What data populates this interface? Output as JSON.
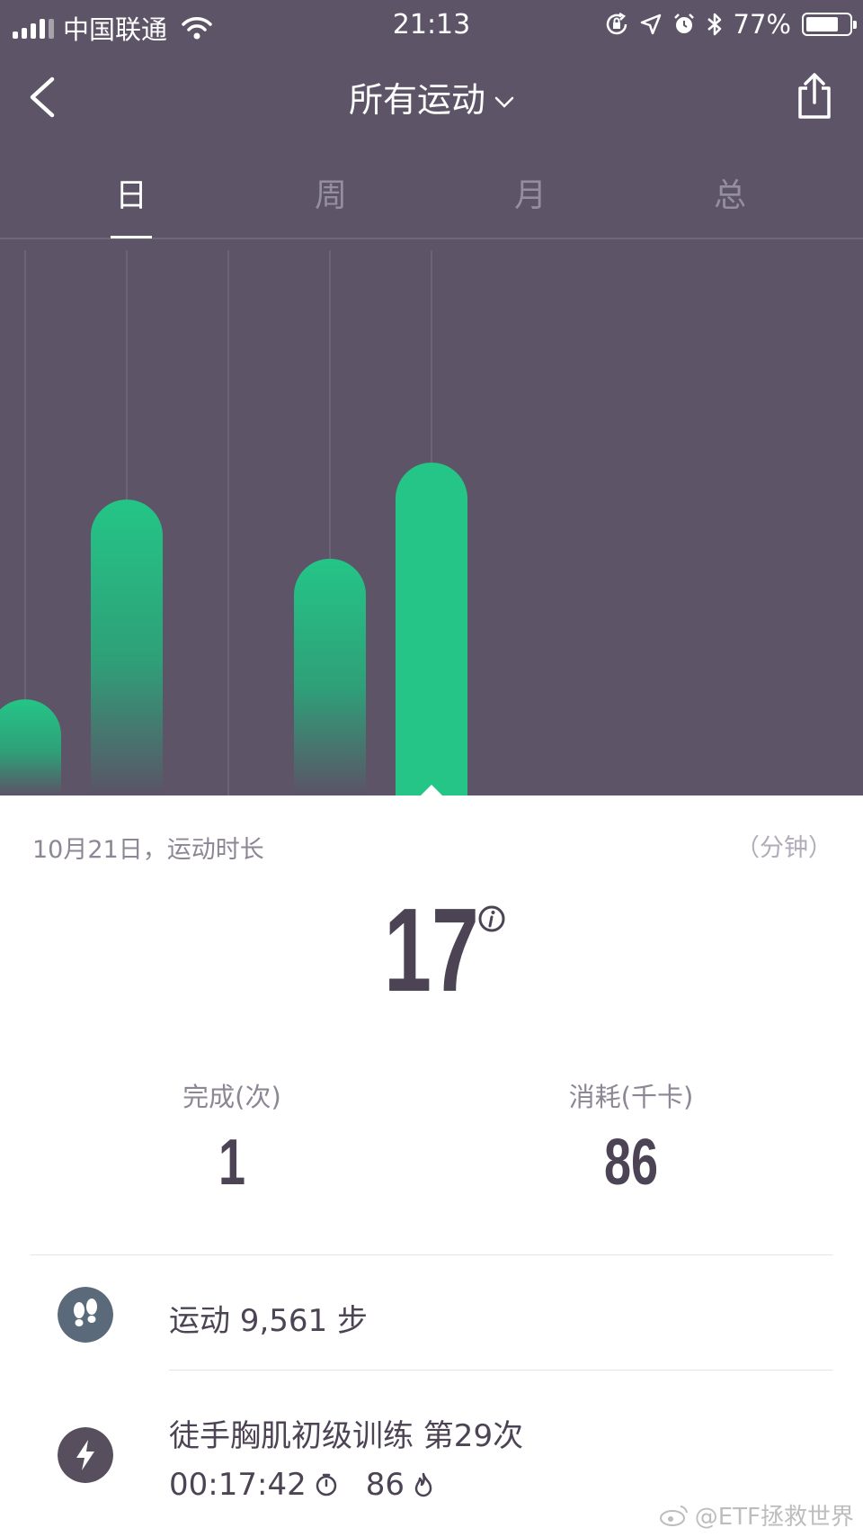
{
  "status_bar": {
    "carrier": "中国联通",
    "time": "21:13",
    "battery_percent": "77%",
    "battery_level": 0.77,
    "icons": [
      "signal-icon",
      "wifi-icon",
      "rotation-lock-icon",
      "location-icon",
      "alarm-icon",
      "bluetooth-icon",
      "battery-icon"
    ]
  },
  "nav": {
    "title": "所有运动",
    "icons": [
      "back-icon",
      "chevron-down-icon",
      "share-icon"
    ]
  },
  "tabs": [
    {
      "label": "日",
      "active": true
    },
    {
      "label": "周",
      "active": false
    },
    {
      "label": "月",
      "active": false
    },
    {
      "label": "总",
      "active": false
    }
  ],
  "colors": {
    "background": "#5d5567",
    "bar": "#24c587",
    "text_dark": "#4c4454",
    "text_muted": "#8d8694"
  },
  "chart_data": {
    "type": "bar",
    "values": [
      13,
      40,
      32,
      45
    ],
    "selected_index": 3
  },
  "summary": {
    "date_label": "10月21日，运动时长",
    "unit_label": "（分钟）",
    "duration": "17",
    "completed_label": "完成(次)",
    "completed_value": "1",
    "calories_label": "消耗(千卡)",
    "calories_value": "86"
  },
  "activities": [
    {
      "icon": "footprints-icon",
      "text": "运动 9,561 步"
    },
    {
      "icon": "lightning-icon",
      "title": "徒手胸肌初级训练  第29次",
      "duration": "00:17:42",
      "calories": "86"
    }
  ],
  "watermark": "@ETF拯救世界"
}
